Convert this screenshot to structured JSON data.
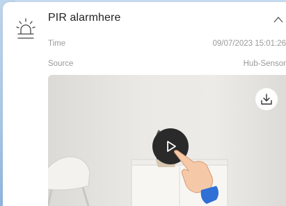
{
  "alarm": {
    "icon": "alarm-light-icon",
    "title": "PIR alarmhere",
    "expand_icon": "chevron-up-icon"
  },
  "details": [
    {
      "label": "Time",
      "value": "09/07/2023 15:01:26"
    },
    {
      "label": "Source",
      "value": "Hub-Sensor"
    }
  ],
  "video": {
    "download_icon": "download-icon",
    "play_icon": "play-icon",
    "pointer_icon": "tap-hand-icon"
  },
  "colors": {
    "page_bg": "#c9def0",
    "card_bg": "#ffffff",
    "muted_text": "#9a9a9a",
    "hand_sleeve": "#2f6fd6"
  }
}
